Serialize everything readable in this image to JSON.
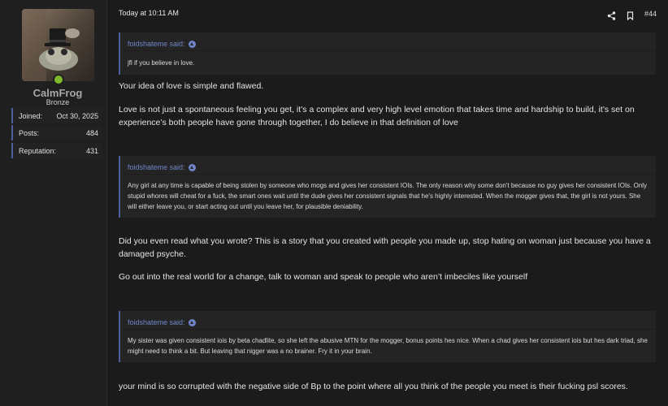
{
  "user": {
    "name": "CalmFrog",
    "rank": "Bronze",
    "stats": [
      {
        "label": "Joined:",
        "value": "Oct 30, 2025"
      },
      {
        "label": "Posts:",
        "value": "484"
      },
      {
        "label": "Reputation:",
        "value": "431"
      }
    ],
    "online_color": "#7fb92b"
  },
  "post": {
    "timestamp": "Today at 10:11 AM",
    "number": "#44",
    "quote1": {
      "author": "foidshateme said:",
      "text": "jfl if you believe in love."
    },
    "reply1": [
      "Your idea of love is simple and flawed.",
      "Love is not just a spontaneous feeling you get, it’s a complex and very high level emotion that takes time and hardship to build, it’s set on experience’s both people have gone through together, I do believe in that definition of love"
    ],
    "quote2": {
      "author": "foidshateme said:",
      "text": "Any girl at any time is capable of being stolen by someone who mogs and gives her consistent IOIs. The only reason why some don't because no guy gives her consistent IOIs. Only stupid whores will cheat for a fuck, the smart ones wait until the dude gives her consistent signals that he's highly interested. When the mogger gives that, the girl is not yours. She will either leave you, or start acting out until you leave her, for plausible deniability."
    },
    "reply2": [
      "Did you even read what you wrote? This is a story that you created with people you made up, stop hating on woman just because you have a damaged psyche.",
      "Go out into the real world for a change, talk to woman and speak to people who aren’t imbeciles like yourself"
    ],
    "quote3": {
      "author": "foidshateme said:",
      "text": "My sister was given consistent iois by beta chadlite, so she left the abusive MTN for the mogger, bonus points hes nice. When a chad gives her consistent iois but hes dark triad, she might need to think a bit. But leaving that nigger was a no brainer. Fry it in your brain."
    },
    "reply3": [
      "your mind is so corrupted with the negative side of Bp to the point where all you think of the people you meet is their fucking psl scores."
    ]
  },
  "icons": {
    "share": "share-icon",
    "bookmark": "bookmark-icon",
    "quote_up": "arrow-up-icon"
  },
  "colors": {
    "accent": "#6e86c9",
    "quote_border": "#4f5f9a",
    "background": "#1b1b1b"
  }
}
